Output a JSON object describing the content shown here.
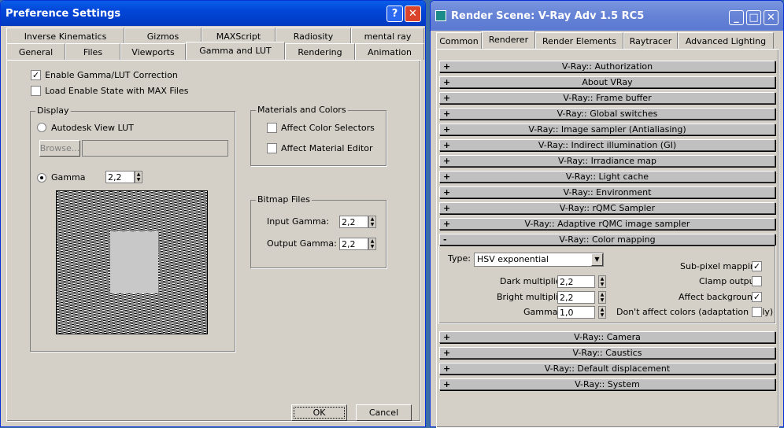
{
  "pref": {
    "title": "Preference Settings",
    "help_btn": "?",
    "close_btn": "✕",
    "tabs_row1": [
      "Inverse Kinematics",
      "Gizmos",
      "MAXScript",
      "Radiosity",
      "mental ray"
    ],
    "tabs_row2": [
      "General",
      "Files",
      "Viewports",
      "Gamma and LUT",
      "Rendering",
      "Animation"
    ],
    "enable_gamma": "Enable Gamma/LUT Correction",
    "load_enable": "Load Enable State with MAX Files",
    "display_group": "Display",
    "autodesk_lut": "Autodesk View LUT",
    "browse": "Browse...",
    "gamma_label": "Gamma",
    "gamma_value": "2,2",
    "materials_group": "Materials and Colors",
    "affect_color": "Affect Color Selectors",
    "affect_material": "Affect Material Editor",
    "bitmap_group": "Bitmap Files",
    "input_gamma_label": "Input Gamma:",
    "input_gamma": "2,2",
    "output_gamma_label": "Output Gamma:",
    "output_gamma": "2,2",
    "ok": "OK",
    "cancel": "Cancel"
  },
  "render": {
    "title": "Render Scene: V-Ray Adv 1.5 RC5",
    "tabs": [
      "Common",
      "Renderer",
      "Render Elements",
      "Raytracer",
      "Advanced Lighting"
    ],
    "rollouts_top": [
      "V-Ray:: Authorization",
      "About VRay",
      "V-Ray:: Frame buffer",
      "V-Ray:: Global switches",
      "V-Ray:: Image sampler (Antialiasing)",
      "V-Ray:: Indirect illumination (GI)",
      "V-Ray:: Irradiance map",
      "V-Ray:: Light cache",
      "V-Ray:: Environment",
      "V-Ray:: rQMC Sampler",
      "V-Ray:: Adaptive rQMC image sampler"
    ],
    "color_mapping": "V-Ray:: Color mapping",
    "type_label": "Type:",
    "type_value": "HSV exponential",
    "dark_label": "Dark multiplier:",
    "dark_value": "2,2",
    "bright_label": "Bright multiplier:",
    "bright_value": "2,2",
    "gamma_label": "Gamma:",
    "gamma_value": "1,0",
    "subpixel": "Sub-pixel mapping",
    "clamp": "Clamp output",
    "affect_bg": "Affect background",
    "dont_affect": "Don't affect colors (adaptation only)",
    "rollouts_bottom": [
      "V-Ray:: Camera",
      "V-Ray:: Caustics",
      "V-Ray:: Default displacement",
      "V-Ray:: System"
    ],
    "plus": "+",
    "minus": "-",
    "check": "✓"
  }
}
